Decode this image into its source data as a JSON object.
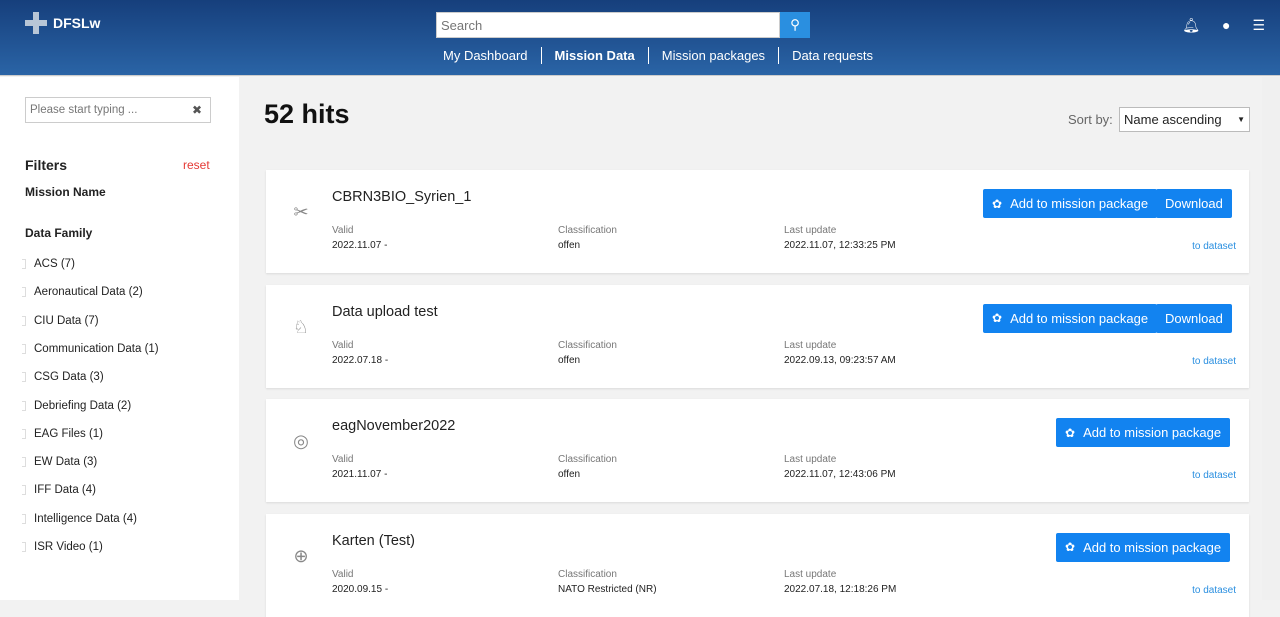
{
  "header": {
    "brand": "DFSLw",
    "search_placeholder": "Search",
    "nav": [
      "My Dashboard",
      "Mission Data",
      "Mission packages",
      "Data requests"
    ],
    "active_nav": "Mission Data"
  },
  "sidebar": {
    "filter_placeholder": "Please start typing ...",
    "filters_title": "Filters",
    "reset": "reset",
    "mission_name": "Mission Name",
    "data_family": "Data Family",
    "families": [
      "ACS (7)",
      "Aeronautical Data (2)",
      "CIU Data (7)",
      "Communication Data (1)",
      "CSG Data (3)",
      "Debriefing Data (2)",
      "EAG Files (1)",
      "EW Data (3)",
      "IFF Data (4)",
      "Intelligence Data (4)",
      "ISR Video (1)"
    ]
  },
  "main": {
    "hits": "52 hits",
    "sort_label": "Sort by:",
    "sort_value": "Name ascending",
    "labels": {
      "valid": "Valid",
      "classification": "Classification",
      "last_update": "Last update",
      "add": "Add to mission package",
      "download": "Download",
      "to_dataset": "to dataset"
    },
    "results": [
      {
        "icon": "biohazard-diamond-icon",
        "glyph": "✂",
        "title": "CBRN3BIO_Syrien_1",
        "valid": "2022.11.07 -",
        "classification": "offen",
        "last_update": "2022.11.07, 12:33:25 PM",
        "download": true
      },
      {
        "icon": "chess-knight-icon",
        "glyph": "♘",
        "title": "Data upload test",
        "valid": "2022.07.18 -",
        "classification": "offen",
        "last_update": "2022.09.13, 09:23:57 AM",
        "download": true
      },
      {
        "icon": "radar-icon",
        "glyph": "◎",
        "title": "eagNovember2022",
        "valid": "2021.11.07 -",
        "classification": "offen",
        "last_update": "2022.11.07, 12:43:06 PM",
        "download": false
      },
      {
        "icon": "map-pin-icon",
        "glyph": "⊕",
        "title": "Karten (Test)",
        "valid": "2020.09.15 -",
        "classification": "NATO Restricted (NR)",
        "last_update": "2022.07.18, 12:18:26 PM",
        "download": false
      }
    ]
  }
}
